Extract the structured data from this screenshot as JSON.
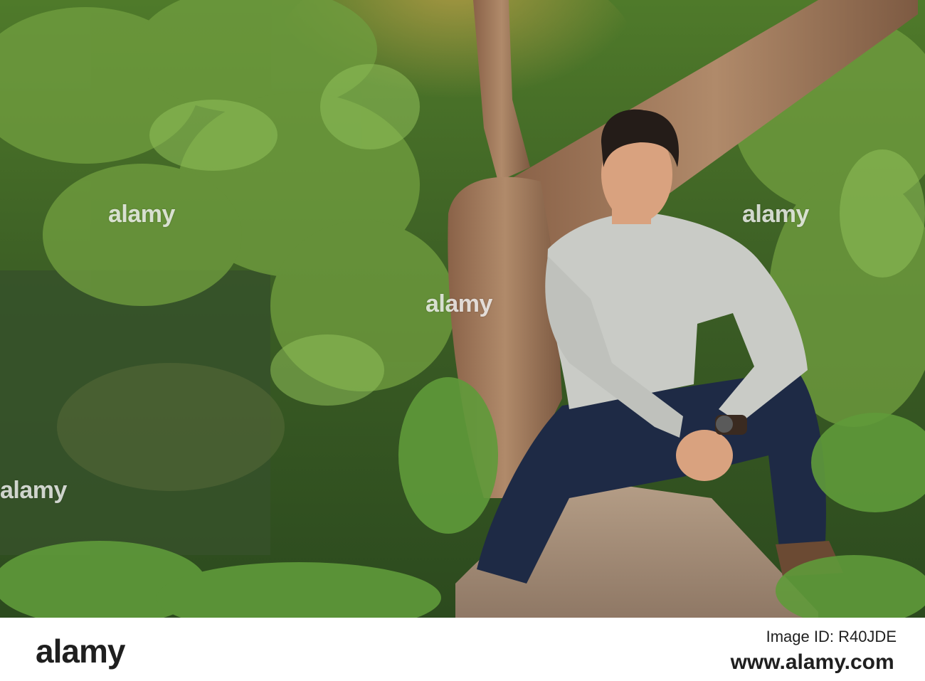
{
  "photo": {
    "subject": "man-sitting-on-tree-trunk",
    "colors": {
      "foliage_dark": "#2f4f1f",
      "foliage_light": "#7fae4a",
      "trunk": "#a07a5a",
      "sweater": "#c9cbc6",
      "jeans": "#1e2a45",
      "skin": "#d9a27f"
    }
  },
  "watermarks": {
    "left": "alamy",
    "center": "alamy",
    "top_left": "alamy",
    "top_right": "alamy"
  },
  "footer": {
    "logo": "alamy",
    "image_id": "Image ID: R40JDE",
    "url": "www.alamy.com"
  }
}
